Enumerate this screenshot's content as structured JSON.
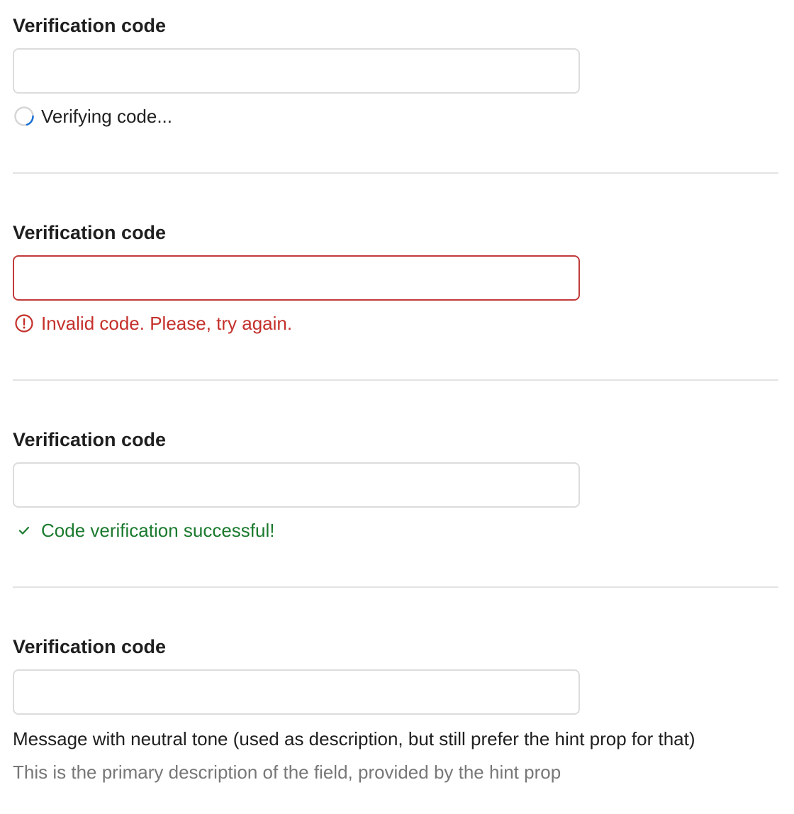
{
  "fields": [
    {
      "label": "Verification code",
      "input_value": "",
      "state": "loading",
      "message": "Verifying code...",
      "message_color": "#1f1f1f",
      "icon": "spinner-icon"
    },
    {
      "label": "Verification code",
      "input_value": "",
      "state": "error",
      "message": "Invalid code. Please, try again.",
      "message_color": "#c4302b",
      "border_color": "#c23a3a",
      "icon": "alert-circle-icon"
    },
    {
      "label": "Verification code",
      "input_value": "",
      "state": "success",
      "message": "Code verification successful!",
      "message_color": "#1a7a2e",
      "icon": "checkmark-icon"
    },
    {
      "label": "Verification code",
      "input_value": "",
      "state": "neutral",
      "message": "Message with neutral tone (used as description, but still prefer the hint prop for that)",
      "message_color": "#1f1f1f",
      "hint": "This is the primary description of the field, provided by the hint prop",
      "hint_color": "#777777"
    }
  ],
  "colors": {
    "divider": "#e3e3e3",
    "input_border": "#dcdcdc",
    "spinner_track": "#d6d6d6",
    "spinner_arc": "#1a6fd8"
  }
}
